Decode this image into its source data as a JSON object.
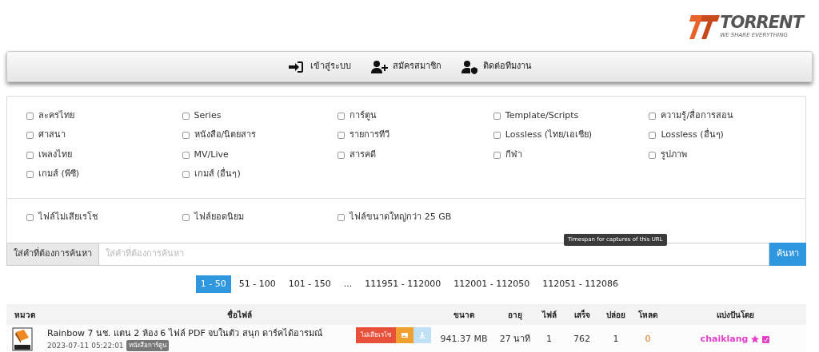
{
  "logo": {
    "name": "TORRENT",
    "tagline": "WE SHARE EVERYTHING"
  },
  "nav": [
    {
      "kind": "login",
      "label": "เข้าสู่ระบบ"
    },
    {
      "kind": "register",
      "label": "สมัครสมาชิก"
    },
    {
      "kind": "contact",
      "label": "ติดต่อทีมงาน"
    }
  ],
  "categories": [
    {
      "label": "ละครไทย",
      "checked": false
    },
    {
      "label": "Series",
      "checked": false
    },
    {
      "label": "การ์ตูน",
      "checked": false
    },
    {
      "label": "Template/Scripts",
      "checked": false
    },
    {
      "label": "ความรู้/สื่อการสอน",
      "checked": false
    },
    {
      "label": "ศาสนา",
      "checked": false
    },
    {
      "label": "หนังสือ/นิตยสาร",
      "checked": false
    },
    {
      "label": "รายการทีวี",
      "checked": false
    },
    {
      "label": "Lossless (ไทย/เอเชีย)",
      "checked": false
    },
    {
      "label": "Lossless (อื่นๆ)",
      "checked": false
    },
    {
      "label": "เพลงไทย",
      "checked": false
    },
    {
      "label": "MV/Live",
      "checked": false
    },
    {
      "label": "สารคดี",
      "checked": false
    },
    {
      "label": "กีฬา",
      "checked": false
    },
    {
      "label": "รูปภาพ",
      "checked": false
    },
    {
      "label": "เกมส์ (พีซี)",
      "checked": false
    },
    {
      "label": "เกมส์ (อื่นๆ)",
      "checked": false
    }
  ],
  "filters": [
    {
      "label": "ไฟล์ไม่เสียเรโช",
      "checked": false
    },
    {
      "label": "ไฟล์ยอดนิยม",
      "checked": false
    },
    {
      "label": "ไฟล์ขนาดใหญ่กว่า 25 GB",
      "checked": false
    }
  ],
  "search": {
    "label": "ใส่คำที่ต้องการค้นหา",
    "placeholder": "ใส่คำที่ต้องการค้นหา",
    "button": "ค้นหา"
  },
  "tooltip": "Timespan for captures of this URL",
  "pagination": {
    "start": [
      {
        "label": "1 - 50",
        "selected": true
      },
      {
        "label": "51 - 100",
        "selected": false
      },
      {
        "label": "101 - 150",
        "selected": false
      }
    ],
    "ellipsis": "...",
    "end": [
      {
        "label": "111951 - 112000",
        "selected": false
      },
      {
        "label": "112001 - 112050",
        "selected": false
      },
      {
        "label": "112051 - 112086",
        "selected": false
      }
    ]
  },
  "table": {
    "columns": [
      "หมวด",
      "ชื่อไฟล์",
      "ขนาด",
      "อายุ",
      "ไฟล์",
      "เสร็จ",
      "ปล่อย",
      "โหลด",
      "แบ่งปันโดย"
    ],
    "rows": [
      {
        "title": "Rainbow 7 นช. แตน 2 ห้อง 6 ไฟล์ PDF จบในตัว สนุก ดาร์คได้อารมณ์",
        "date": "2023-07-11 05:22:01",
        "tag": "หนังสือการ์ตูน",
        "badge": "ไม่เสียเรโช",
        "size": "941.37 MB",
        "age": "27 นาที",
        "files": "1",
        "completed": "762",
        "seeders": "1",
        "leechers": "0",
        "uploader": "chaiklang"
      }
    ]
  }
}
